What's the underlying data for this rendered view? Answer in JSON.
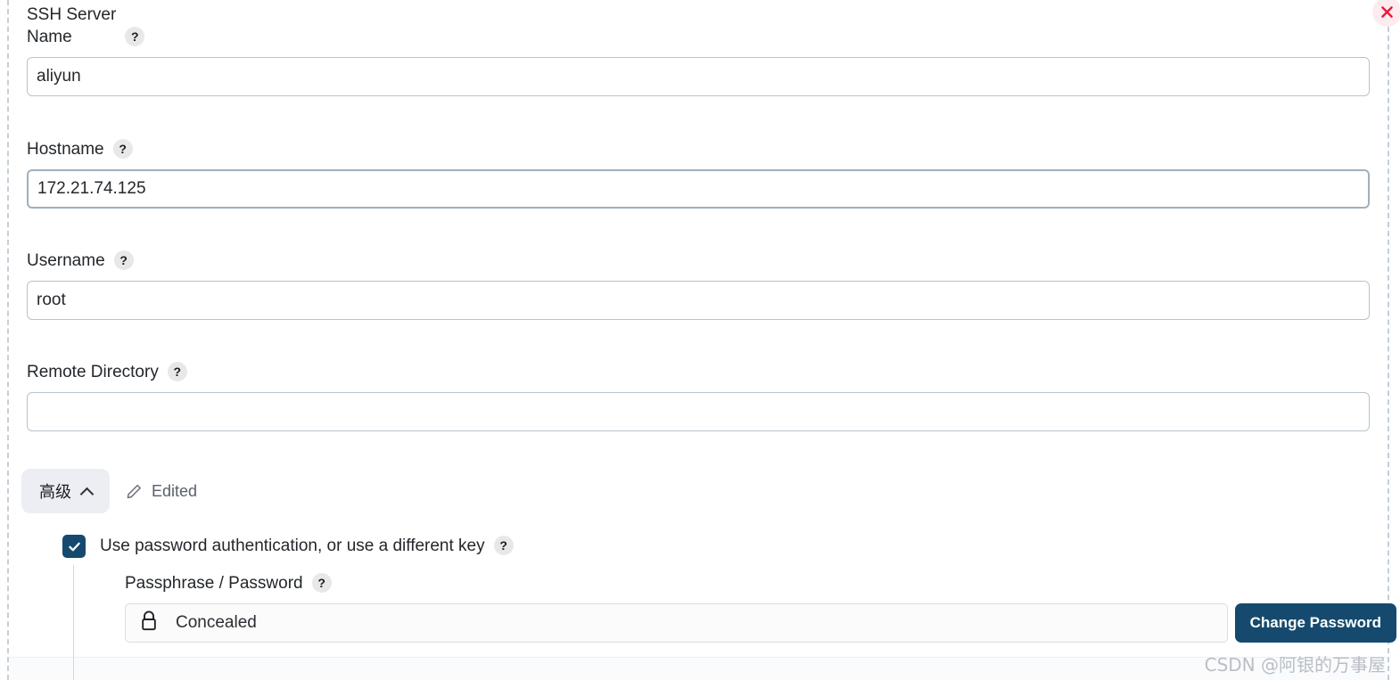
{
  "dialog": {
    "close_label": "×",
    "close_icon": "close-icon"
  },
  "fields": {
    "name": {
      "label": "SSH Server\nName",
      "help": "?",
      "value": "aliyun",
      "placeholder": ""
    },
    "hostname": {
      "label": "Hostname",
      "help": "?",
      "value": "172.21.74.125",
      "placeholder": ""
    },
    "username": {
      "label": "Username",
      "help": "?",
      "value": "root",
      "placeholder": ""
    },
    "remote_directory": {
      "label": "Remote Directory",
      "help": "?",
      "value": "",
      "placeholder": ""
    }
  },
  "advanced": {
    "toggle_label": "高级",
    "chevron": "chevron-up-icon",
    "edited_label": "Edited",
    "edit_icon": "pencil-icon",
    "checkbox": {
      "checked": true,
      "label": "Use password authentication, or use a different key",
      "help": "?"
    },
    "passphrase": {
      "label": "Passphrase / Password",
      "help": "?",
      "value": "Concealed",
      "lock_icon": "lock-icon",
      "button_label": "Change Password"
    }
  },
  "watermark": {
    "text": "CSDN @阿银的万事屋"
  },
  "colors": {
    "accent": "#154a6e",
    "close_bg": "#fdecef",
    "close_fg": "#e8193c",
    "input_border": "#b7c4ce",
    "advanced_bg": "#eceef4",
    "help_bg": "#e8e8e8"
  }
}
